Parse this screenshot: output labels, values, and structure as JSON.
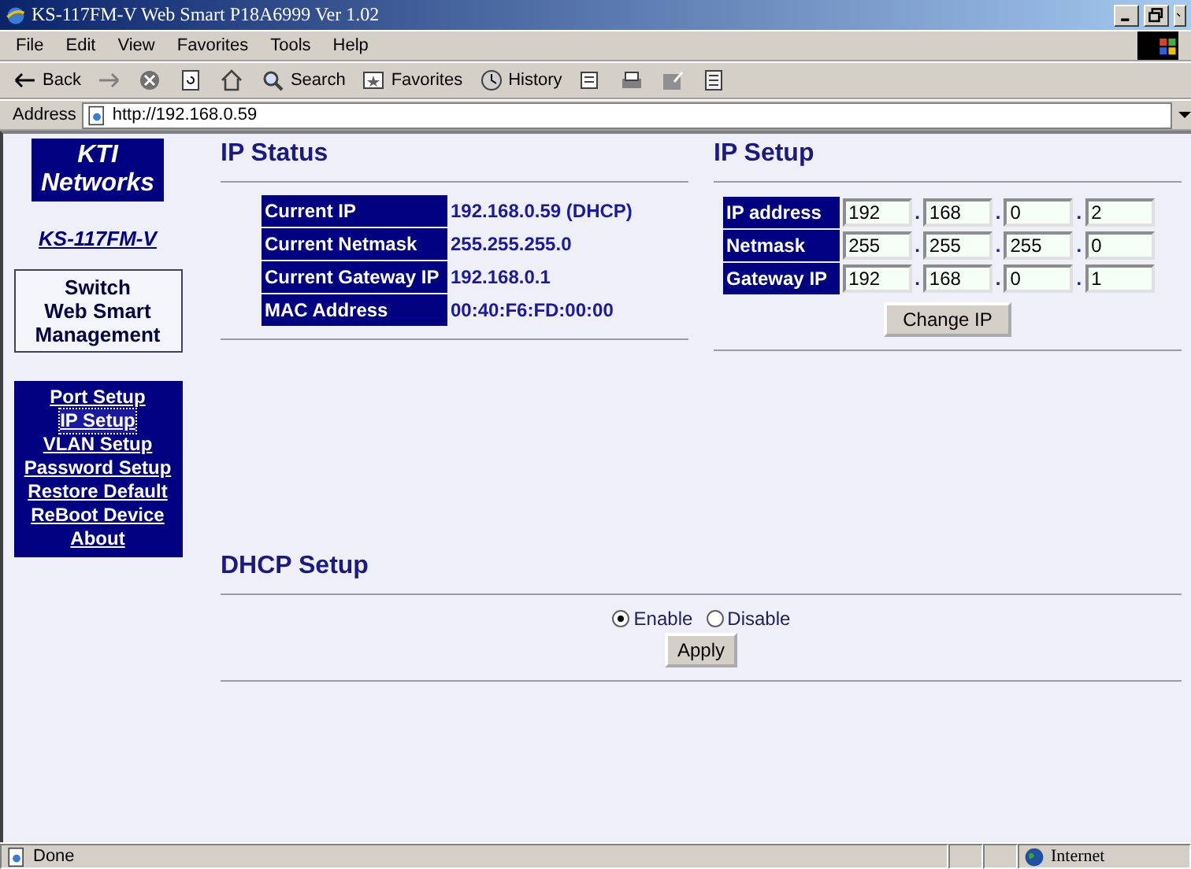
{
  "window": {
    "title": "KS-117FM-V Web Smart P18A6999 Ver 1.02"
  },
  "menu": [
    "File",
    "Edit",
    "View",
    "Favorites",
    "Tools",
    "Help"
  ],
  "toolbar": {
    "back": "Back",
    "search": "Search",
    "favorites": "Favorites",
    "history": "History"
  },
  "address": {
    "label": "Address",
    "value": "http://192.168.0.59"
  },
  "sidebar": {
    "logo": [
      "KTI",
      "Networks"
    ],
    "model": "KS-117FM-V",
    "product": [
      "Switch",
      "Web Smart",
      "Management"
    ],
    "nav": [
      {
        "label": "Port Setup",
        "selected": false
      },
      {
        "label": "IP Setup",
        "selected": true
      },
      {
        "label": "VLAN Setup",
        "selected": false
      },
      {
        "label": "Password Setup",
        "selected": false
      },
      {
        "label": "Restore Default",
        "selected": false
      },
      {
        "label": "ReBoot Device",
        "selected": false
      },
      {
        "label": "About",
        "selected": false
      }
    ]
  },
  "ip_status": {
    "title": "IP Status",
    "rows": [
      {
        "label": "Current IP",
        "value": "192.168.0.59 (DHCP)"
      },
      {
        "label": "Current Netmask",
        "value": "255.255.255.0"
      },
      {
        "label": "Current Gateway IP",
        "value": "192.168.0.1"
      },
      {
        "label": "MAC Address",
        "value": "00:40:F6:FD:00:00"
      }
    ]
  },
  "ip_setup": {
    "title": "IP Setup",
    "rows": [
      {
        "label": "IP address",
        "octets": [
          "192",
          "168",
          "0",
          "2"
        ]
      },
      {
        "label": "Netmask",
        "octets": [
          "255",
          "255",
          "255",
          "0"
        ]
      },
      {
        "label": "Gateway IP",
        "octets": [
          "192",
          "168",
          "0",
          "1"
        ]
      }
    ],
    "separator": ".",
    "button": "Change IP"
  },
  "dhcp": {
    "title": "DHCP Setup",
    "options": [
      {
        "label": "Enable",
        "selected": true
      },
      {
        "label": "Disable",
        "selected": false
      }
    ],
    "button": "Apply"
  },
  "status_bar": {
    "text": "Done",
    "zone": "Internet"
  }
}
